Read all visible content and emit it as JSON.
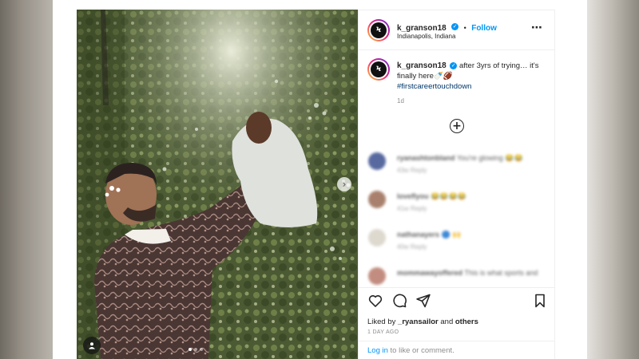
{
  "post": {
    "username": "k_granson18",
    "verified_glyph": "✓",
    "separator": "•",
    "follow_label": "Follow",
    "location": "Indianapolis, Indiana",
    "avatar_letter": "Ϟ",
    "more_icon": "more-horizontal-icon",
    "caption": "after 3yrs of trying… it's finally here🍼🏈",
    "hashtag": "#firstcareertouchdown",
    "caption_age": "1d",
    "load_more_icon": "plus-circle-icon",
    "comments": [
      {
        "user": "ryanashtonbland",
        "text": "You're glowing 😂😂",
        "meta": "43w   Reply",
        "avatar_color": "#3b4f8f"
      },
      {
        "user": "loveflyou",
        "text": "😂😂😂😂",
        "meta": "41w   Reply",
        "avatar_color": "#9a6b54"
      },
      {
        "user": "nathanayers",
        "text": "🔵 🙌",
        "meta": "40w   Reply",
        "avatar_color": "#d8d3c6"
      },
      {
        "user": "mommawayoffered",
        "text": "This is what sports and",
        "meta": "",
        "avatar_color": "#b87a6a"
      }
    ],
    "actions": {
      "like_icon": "heart-icon",
      "comment_icon": "comment-icon",
      "share_icon": "send-icon",
      "save_icon": "bookmark-icon"
    },
    "liked_by_prefix": "Liked by",
    "liked_by_user": "_ryansailor",
    "liked_by_and": "and",
    "liked_by_others": "others",
    "date": "1 DAY AGO",
    "login_link": "Log in",
    "login_suffix": " to like or comment."
  },
  "photo": {
    "next_arrow": "›",
    "tag_icon": "user-tag-icon",
    "carousel_total": 3,
    "carousel_active": 1
  },
  "colors": {
    "accent": "#0095f6",
    "hashtag": "#00376b",
    "muted": "#8e8e8e"
  }
}
